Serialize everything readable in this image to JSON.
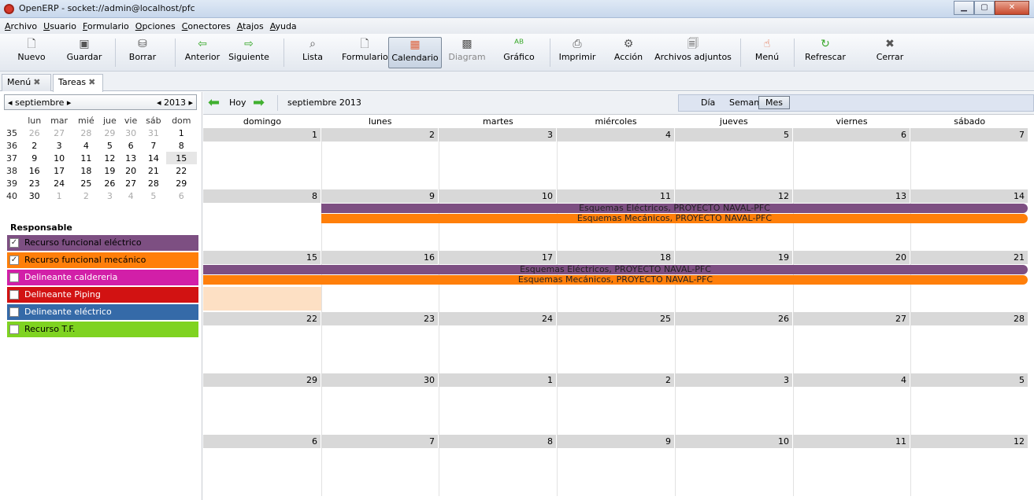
{
  "window": {
    "title": "OpenERP - socket://admin@localhost/pfc"
  },
  "menu": [
    "Archivo",
    "Usuario",
    "Formulario",
    "Opciones",
    "Conectores",
    "Atajos",
    "Ayuda"
  ],
  "toolbar": {
    "nuevo": "Nuevo",
    "guardar": "Guardar",
    "borrar": "Borrar",
    "anterior": "Anterior",
    "siguiente": "Siguiente",
    "lista": "Lista",
    "formulario": "Formulario",
    "calendario": "Calendario",
    "diagram": "Diagram",
    "grafico": "Gráfico",
    "imprimir": "Imprimir",
    "accion": "Acción",
    "adjuntos": "Archivos adjuntos",
    "menu": "Menú",
    "refrescar": "Refrescar",
    "cerrar": "Cerrar"
  },
  "tabs": [
    "Menú",
    "Tareas"
  ],
  "mini_calendar": {
    "month": "septiembre",
    "year": "2013",
    "day_headers": [
      "lun",
      "mar",
      "mié",
      "jue",
      "vie",
      "sáb",
      "dom"
    ],
    "weeks": [
      {
        "wk": "35",
        "days": [
          "26",
          "27",
          "28",
          "29",
          "30",
          "31",
          "1"
        ]
      },
      {
        "wk": "36",
        "days": [
          "2",
          "3",
          "4",
          "5",
          "6",
          "7",
          "8"
        ]
      },
      {
        "wk": "37",
        "days": [
          "9",
          "10",
          "11",
          "12",
          "13",
          "14",
          "15"
        ]
      },
      {
        "wk": "38",
        "days": [
          "16",
          "17",
          "18",
          "19",
          "20",
          "21",
          "22"
        ]
      },
      {
        "wk": "39",
        "days": [
          "23",
          "24",
          "25",
          "26",
          "27",
          "28",
          "29"
        ]
      },
      {
        "wk": "40",
        "days": [
          "30",
          "1",
          "2",
          "3",
          "4",
          "5",
          "6"
        ]
      }
    ]
  },
  "responsables": {
    "title": "Responsable",
    "items": [
      {
        "label": "Recurso funcional eléctrico",
        "checked": true,
        "color": "#7d4f82",
        "text": "#000000"
      },
      {
        "label": "Recurso funcional mecánico",
        "checked": true,
        "color": "#ff7f0a",
        "text": "#000000"
      },
      {
        "label": "Delineante caldereria",
        "checked": false,
        "color": "#d21fa8",
        "text": "#ffffff"
      },
      {
        "label": "Delineante Piping",
        "checked": false,
        "color": "#d21212",
        "text": "#ffffff"
      },
      {
        "label": "Delineante eléctrico",
        "checked": false,
        "color": "#356aa8",
        "text": "#ffffff"
      },
      {
        "label": "Recurso T.F.",
        "checked": false,
        "color": "#7fd321",
        "text": "#000000"
      }
    ]
  },
  "calendar": {
    "today_label": "Hoy",
    "current": "septiembre 2013",
    "modes": [
      "Día",
      "Semana",
      "Mes"
    ],
    "active_mode": "Mes",
    "weekdays": [
      "domingo",
      "lunes",
      "martes",
      "miércoles",
      "jueves",
      "viernes",
      "sábado"
    ],
    "weeks": [
      [
        "1",
        "2",
        "3",
        "4",
        "5",
        "6",
        "7"
      ],
      [
        "8",
        "9",
        "10",
        "11",
        "12",
        "13",
        "14"
      ],
      [
        "15",
        "16",
        "17",
        "18",
        "19",
        "20",
        "21"
      ],
      [
        "22",
        "23",
        "24",
        "25",
        "26",
        "27",
        "28"
      ],
      [
        "29",
        "30",
        "1",
        "2",
        "3",
        "4",
        "5"
      ],
      [
        "6",
        "7",
        "8",
        "9",
        "10",
        "11",
        "12"
      ]
    ],
    "events": [
      {
        "label": "Esquemas Eléctricos, PROYECTO NAVAL-PFC",
        "color": "#7d4f82",
        "week": 1,
        "start": 1,
        "end": 7
      },
      {
        "label": "Esquemas Mecánicos, PROYECTO NAVAL-PFC",
        "color": "#ff7f0a",
        "week": 1,
        "start": 1,
        "end": 7
      },
      {
        "label": "Esquemas Eléctricos, PROYECTO NAVAL-PFC",
        "color": "#7d4f82",
        "week": 2,
        "start": 0,
        "end": 7
      },
      {
        "label": "Esquemas Mecánicos, PROYECTO NAVAL-PFC",
        "color": "#ff7f0a",
        "week": 2,
        "start": 0,
        "end": 7
      }
    ]
  }
}
